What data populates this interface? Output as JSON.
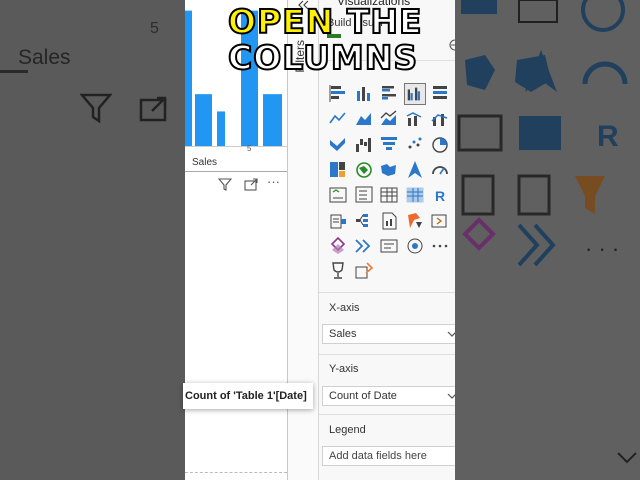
{
  "overlay": {
    "line1_highlight": "OPEN",
    "line1_rest": " THE",
    "line2": "COLUMNS"
  },
  "left_bg": {
    "tick": "5",
    "title": "Sales"
  },
  "canvas": {
    "axis_label": "Sales",
    "tick": "5",
    "bar_values": [
      0.94,
      0.36,
      0.24,
      0.94,
      0.36
    ],
    "bar_color": "#2196f3"
  },
  "pane": {
    "title": "Visualizations",
    "tab": "Build visual",
    "filters_label": "Filters",
    "more_glyph": "···",
    "x_axis": {
      "label": "X-axis",
      "value": "Sales"
    },
    "y_axis": {
      "label": "Y-axis",
      "value": "Count of Date"
    },
    "legend": {
      "label": "Legend",
      "placeholder": "Add data fields here"
    },
    "tooltip": "Count of 'Table 1'[Date]"
  },
  "icons": [
    "stacked-bar-chart",
    "stacked-column-chart",
    "clustered-bar-chart",
    "clustered-column-chart",
    "100-stacked-bar-chart",
    "line-chart",
    "area-chart",
    "stacked-area-chart",
    "line-stacked-column-chart",
    "line-clustered-column-chart",
    "ribbon-chart",
    "waterfall-chart",
    "funnel-chart",
    "scatter-chart",
    "pie-chart",
    "treemap",
    "map",
    "filled-map",
    "azure-map",
    "gauge",
    "kpi",
    "slicer",
    "table",
    "matrix",
    "r-visual",
    "smart-narrative",
    "decomposition-tree",
    "paginated-report",
    "power-apps",
    "power-automate",
    "key-influencers",
    "qa",
    "narrative",
    "goals",
    "more-visuals",
    "trophy",
    "custom-visual"
  ]
}
